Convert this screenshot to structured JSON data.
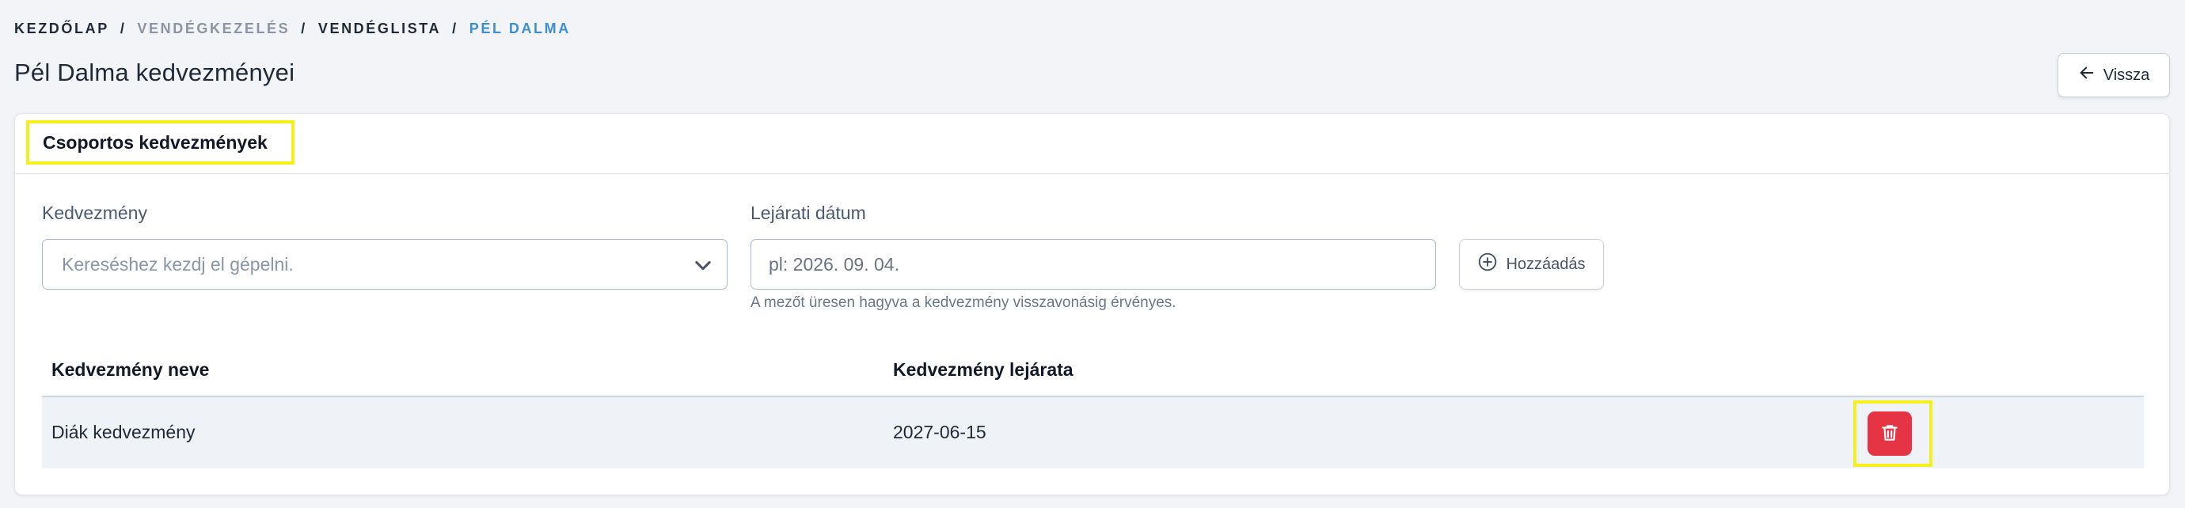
{
  "breadcrumb": {
    "items": [
      "KEZDŐLAP",
      "VENDÉGKEZELÉS",
      "VENDÉGLISTA",
      "PÉL DALMA"
    ],
    "separator": "/"
  },
  "page": {
    "title": "Pél Dalma kedvezményei",
    "back_label": "Vissza"
  },
  "card": {
    "title": "Csoportos kedvezmények",
    "discount_label": "Kedvezmény",
    "discount_placeholder": "Kereséshez kezdj el gépelni.",
    "expiry_label": "Lejárati dátum",
    "expiry_placeholder": "pl: 2026. 09. 04.",
    "expiry_help": "A mezőt üresen hagyva a kedvezmény visszavonásig érvényes.",
    "add_label": "Hozzáadás"
  },
  "table": {
    "columns": [
      "Kedvezmény neve",
      "Kedvezmény lejárata"
    ],
    "rows": [
      {
        "name": "Diák kedvezmény",
        "expiry": "2027-06-15"
      }
    ]
  },
  "colors": {
    "accent": "#3d8fd1",
    "danger": "#e53545",
    "highlight": "#f5ef1a",
    "background": "#f2f4f7"
  }
}
